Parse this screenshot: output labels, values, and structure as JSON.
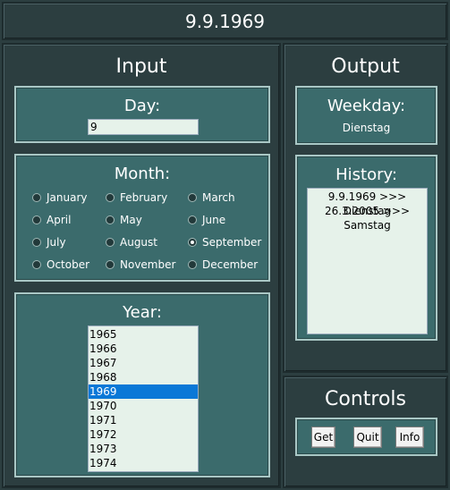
{
  "window": {
    "title": "9.9.1969"
  },
  "input": {
    "title": "Input",
    "day": {
      "label": "Day:",
      "value": "9"
    },
    "month": {
      "label": "Month:",
      "options": [
        "January",
        "February",
        "March",
        "April",
        "May",
        "June",
        "July",
        "August",
        "September",
        "October",
        "November",
        "December"
      ],
      "selected": "September"
    },
    "year": {
      "label": "Year:",
      "items": [
        "1965",
        "1966",
        "1967",
        "1968",
        "1969",
        "1970",
        "1971",
        "1972",
        "1973",
        "1974"
      ],
      "selected": "1969"
    }
  },
  "output": {
    "title": "Output",
    "weekday": {
      "label": "Weekday:",
      "value": "Dienstag"
    },
    "history": {
      "label": "History:",
      "items": [
        "9.9.1969 >>> Dienstag",
        "26.3.2005 >>> Samstag"
      ]
    }
  },
  "controls": {
    "title": "Controls",
    "get_label": "Get",
    "quit_label": "Quit",
    "info_label": "Info"
  },
  "colors": {
    "background": "#2c3e40",
    "panel": "#3b6b6c",
    "selection": "#0a78d7",
    "field": "#e6f2ea"
  }
}
